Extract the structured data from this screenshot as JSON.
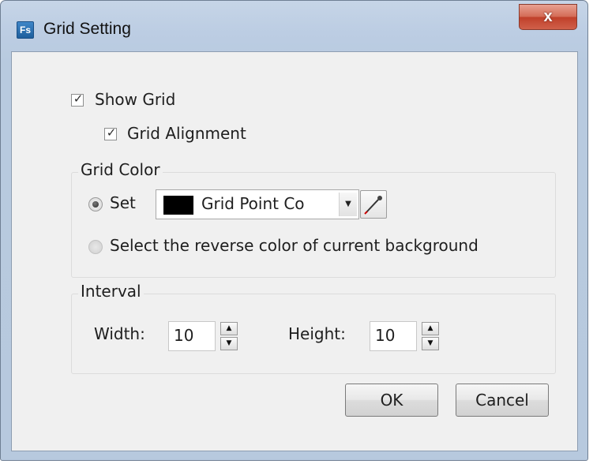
{
  "window": {
    "title": "Grid Setting",
    "app_icon_text": "Fs",
    "close_label": "x"
  },
  "show_grid": {
    "label": "Show Grid",
    "checked": true
  },
  "grid_alignment": {
    "label": "Grid Alignment",
    "checked": true
  },
  "grid_color": {
    "group_title": "Grid Color",
    "set_label": "Set",
    "set_selected": true,
    "combo_value": "Grid Point Co",
    "swatch_color": "#000000",
    "reverse_label": "Select the reverse color of current background",
    "reverse_selected": false
  },
  "interval": {
    "group_title": "Interval",
    "width_label": "Width:",
    "width_value": "10",
    "height_label": "Height:",
    "height_value": "10"
  },
  "buttons": {
    "ok": "OK",
    "cancel": "Cancel"
  }
}
